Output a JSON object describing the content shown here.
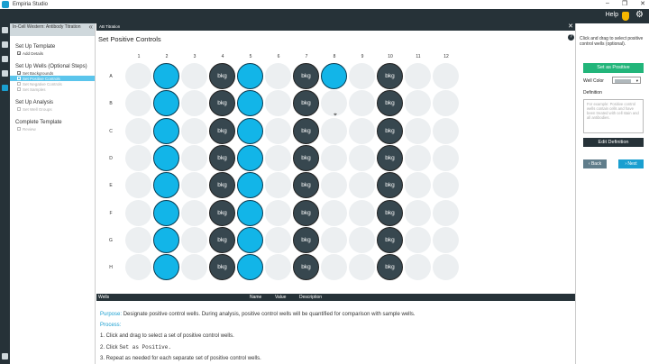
{
  "window": {
    "title": "Empiria Studio",
    "controls": [
      "–",
      "❐",
      "✕"
    ]
  },
  "header": {
    "help_label": "Help"
  },
  "steps_panel": {
    "title": "In-Cell Western: Antibody Titration",
    "sections": [
      {
        "label": "Set Up Template",
        "items": [
          {
            "label": "Add Details",
            "state": "checked"
          }
        ]
      },
      {
        "label": "Set Up Wells (Optional Steps)",
        "items": [
          {
            "label": "Set Backgrounds",
            "state": "checked"
          },
          {
            "label": "Set Positive Controls",
            "state": "active"
          },
          {
            "label": "Set Negative Controls",
            "state": "dim"
          },
          {
            "label": "Set Samples",
            "state": "dim"
          }
        ]
      },
      {
        "label": "Set Up Analysis",
        "items": [
          {
            "label": "Set Well Groups",
            "state": "dim"
          }
        ]
      },
      {
        "label": "Complete Template",
        "items": [
          {
            "label": "Review",
            "state": "dim"
          }
        ]
      }
    ]
  },
  "main": {
    "tab_label": "AB Titration",
    "section_title": "Set Positive Controls",
    "plate": {
      "columns": [
        "1",
        "2",
        "3",
        "4",
        "5",
        "6",
        "7",
        "8",
        "9",
        "10",
        "11",
        "12"
      ],
      "rows": [
        "A",
        "B",
        "C",
        "D",
        "E",
        "F",
        "G",
        "H"
      ],
      "bkg_label": "bkg",
      "wells": [
        [
          "empty",
          "pos",
          "empty",
          "bkg",
          "pos",
          "empty",
          "bkg",
          "pos",
          "empty",
          "bkg",
          "empty",
          "empty"
        ],
        [
          "empty",
          "pos",
          "empty",
          "bkg",
          "pos",
          "empty",
          "bkg",
          "empty",
          "empty",
          "bkg",
          "empty",
          "empty"
        ],
        [
          "empty",
          "pos",
          "empty",
          "bkg",
          "pos",
          "empty",
          "bkg",
          "empty",
          "empty",
          "bkg",
          "empty",
          "empty"
        ],
        [
          "empty",
          "pos",
          "empty",
          "bkg",
          "pos",
          "empty",
          "bkg",
          "empty",
          "empty",
          "bkg",
          "empty",
          "empty"
        ],
        [
          "empty",
          "pos",
          "empty",
          "bkg",
          "pos",
          "empty",
          "bkg",
          "empty",
          "empty",
          "bkg",
          "empty",
          "empty"
        ],
        [
          "empty",
          "pos",
          "empty",
          "bkg",
          "pos",
          "empty",
          "bkg",
          "empty",
          "empty",
          "bkg",
          "empty",
          "empty"
        ],
        [
          "empty",
          "pos",
          "empty",
          "bkg",
          "pos",
          "empty",
          "bkg",
          "empty",
          "empty",
          "bkg",
          "empty",
          "empty"
        ],
        [
          "empty",
          "pos",
          "empty",
          "bkg",
          "pos",
          "empty",
          "bkg",
          "empty",
          "empty",
          "bkg",
          "empty",
          "empty"
        ]
      ]
    },
    "wells_table": {
      "headers": [
        "Wells",
        "Name",
        "Value",
        "Description"
      ]
    },
    "help": {
      "purpose_label": "Purpose:",
      "purpose_text": "Designate positive control wells. During analysis, positive control wells will be quantified for comparison with sample wells.",
      "process_label": "Process:",
      "steps": [
        "1. Click and drag to select a set of positive control wells.",
        "2. Click ",
        "3. Repeat as needed for each separate set of positive control wells."
      ],
      "step2_code": "Set as Positive."
    }
  },
  "right_panel": {
    "instruction": "Click and drag to select positive control wells (optional).",
    "set_button": "Set as Positive",
    "well_color_label": "Well Color",
    "definition_label": "Definition",
    "definition_placeholder": "For example: Positive control wells contain cells and have been treated with cell stain and all antibodies.",
    "edit_button": "Edit Definition",
    "back_button": "Back",
    "next_button": "Next"
  },
  "colors": {
    "positive": "#12b5e8",
    "background": "#37474f",
    "empty": "#eceff1",
    "header": "#263238",
    "accent": "#1a9fd0",
    "set_button": "#22b57a"
  }
}
